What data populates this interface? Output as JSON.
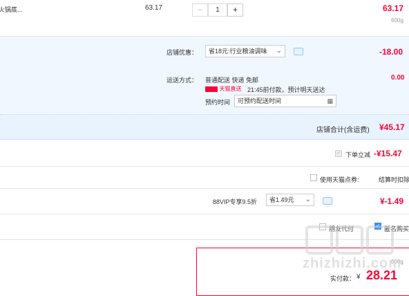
{
  "item": {
    "name": "火锅底...",
    "unit_price": "63.17",
    "quantity": "1",
    "minus": "−",
    "plus": "+",
    "subtotal": "63.17",
    "weight": "600g"
  },
  "shop": {
    "discount_label": "店铺优惠：",
    "discount_select": "省18元:行业粮油调味",
    "discount_amount": "-18.00",
    "shipping_label": "运送方式：",
    "shipping_desc": "普通配送 快递 免邮",
    "tmall_badge": "天猫直送",
    "delivery_note": "21:45前付款，预计明天送达",
    "appt_label": "预约时间",
    "appt_placeholder": "可预约配送时间",
    "shipping_amount": "0.00",
    "total_label": "店铺合计(含运费)",
    "total_amount": "¥45.17"
  },
  "instant_discount": {
    "label": "下单立减",
    "amount": "-¥15.47"
  },
  "points": {
    "label": "使用天猫点券:",
    "note": "结算时扣除"
  },
  "vip": {
    "label": "88VIP专享9.5折",
    "select": "省1.49元",
    "amount": "¥-1.49"
  },
  "options": {
    "friend_pay": "朋友代付",
    "anonymous": "匿名购买"
  },
  "summary": {
    "weight": "600g",
    "paid_label": "实付款：",
    "currency": "¥",
    "amount": "28.21"
  },
  "watermark": {
    "logo": "值值值",
    "site": "zhizhizhi.com"
  },
  "colors": {
    "accent": "#ff0036",
    "shop_bg": "#f1f7ff",
    "total_bg": "#e8f3fd"
  }
}
